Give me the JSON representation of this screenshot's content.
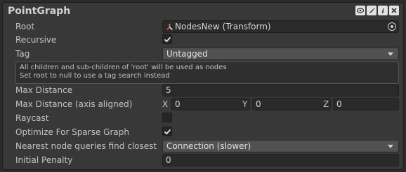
{
  "header": {
    "title": "PointGraph"
  },
  "fields": {
    "root": {
      "label": "Root",
      "value": "NodesNew (Transform)"
    },
    "recursive": {
      "label": "Recursive",
      "checked": true
    },
    "tag": {
      "label": "Tag",
      "value": "Untagged"
    },
    "help": {
      "line1": "All children and sub-children of 'root' will be used as nodes",
      "line2": "Set root to null to use a tag search instead"
    },
    "max_distance": {
      "label": "Max Distance",
      "value": "5"
    },
    "max_distance_axis": {
      "label": "Max Distance (axis aligned)",
      "x_label": "X",
      "x_value": "0",
      "y_label": "Y",
      "y_value": "0",
      "z_label": "Z",
      "z_value": "0"
    },
    "raycast": {
      "label": "Raycast",
      "checked": false
    },
    "optimize_sparse": {
      "label": "Optimize For Sparse Graph",
      "checked": true
    },
    "nearest_node": {
      "label": "Nearest node queries find closest",
      "value": "Connection (slower)"
    },
    "initial_penalty": {
      "label": "Initial Penalty",
      "value": "0"
    }
  }
}
